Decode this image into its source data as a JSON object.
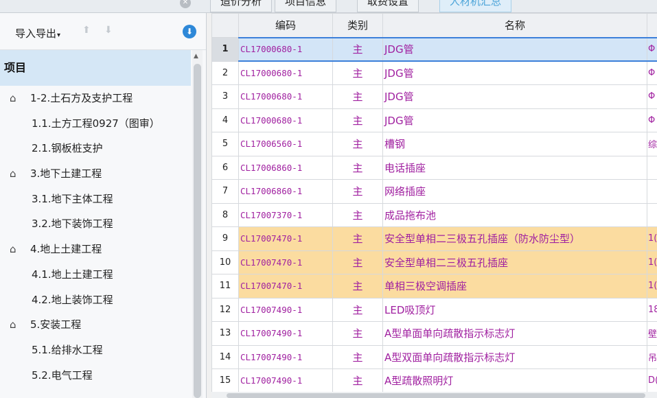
{
  "tabs": [
    {
      "label": "造价分析",
      "active": false
    },
    {
      "label": "项目信息",
      "active": false
    },
    {
      "label": "取费设置",
      "active": false
    },
    {
      "label": "人材机汇总",
      "active": true
    }
  ],
  "toolbar": {
    "import_export_label": "导入导出",
    "up_icon": "arrow-up-icon",
    "down_icon": "arrow-down-icon",
    "download_icon": "download-icon"
  },
  "tree": {
    "root_label": "项目",
    "items": [
      {
        "label": "1-2.土石方及支护工程",
        "level": 1
      },
      {
        "label": "1.1.土方工程0927（图审）",
        "level": 2
      },
      {
        "label": "2.1.钢板桩支护",
        "level": 2
      },
      {
        "label": "3.地下土建工程",
        "level": 1
      },
      {
        "label": "3.1.地下主体工程",
        "level": 2
      },
      {
        "label": "3.2.地下装饰工程",
        "level": 2
      },
      {
        "label": "4.地上土建工程",
        "level": 1
      },
      {
        "label": "4.1.地上土建工程",
        "level": 2
      },
      {
        "label": "4.2.地上装饰工程",
        "level": 2
      },
      {
        "label": "5.安装工程",
        "level": 1
      },
      {
        "label": "5.1.给排水工程",
        "level": 2
      },
      {
        "label": "5.2.电气工程",
        "level": 2
      }
    ]
  },
  "table": {
    "headers": [
      "编码",
      "类别",
      "名称"
    ],
    "rows": [
      {
        "no": "1",
        "code": "CL17000680-1",
        "type": "主",
        "name": "JDG管",
        "spec": "Φ",
        "state": "selected"
      },
      {
        "no": "2",
        "code": "CL17000680-1",
        "type": "主",
        "name": "JDG管",
        "spec": "Φ",
        "state": ""
      },
      {
        "no": "3",
        "code": "CL17000680-1",
        "type": "主",
        "name": "JDG管",
        "spec": "Φ",
        "state": ""
      },
      {
        "no": "4",
        "code": "CL17000680-1",
        "type": "主",
        "name": "JDG管",
        "spec": "Φ",
        "state": ""
      },
      {
        "no": "5",
        "code": "CL17006560-1",
        "type": "主",
        "name": "槽钢",
        "spec": "综",
        "state": ""
      },
      {
        "no": "6",
        "code": "CL17006860-1",
        "type": "主",
        "name": "电话插座",
        "spec": "",
        "state": ""
      },
      {
        "no": "7",
        "code": "CL17006860-1",
        "type": "主",
        "name": "网络插座",
        "spec": "",
        "state": ""
      },
      {
        "no": "8",
        "code": "CL17007370-1",
        "type": "主",
        "name": "成品拖布池",
        "spec": "",
        "state": ""
      },
      {
        "no": "9",
        "code": "CL17007470-1",
        "type": "主",
        "name": "安全型单相二三极五孔插座（防水防尘型）",
        "spec": "1(",
        "state": "highlight"
      },
      {
        "no": "10",
        "code": "CL17007470-1",
        "type": "主",
        "name": "安全型单相二三极五孔插座",
        "spec": "1(",
        "state": "highlight"
      },
      {
        "no": "11",
        "code": "CL17007470-1",
        "type": "主",
        "name": "单相三极空调插座",
        "spec": "1(",
        "state": "highlight"
      },
      {
        "no": "12",
        "code": "CL17007490-1",
        "type": "主",
        "name": "LED吸顶灯",
        "spec": "18",
        "state": ""
      },
      {
        "no": "13",
        "code": "CL17007490-1",
        "type": "主",
        "name": "A型单面单向疏散指示标志灯",
        "spec": "壁",
        "state": ""
      },
      {
        "no": "14",
        "code": "CL17007490-1",
        "type": "主",
        "name": "A型双面单向疏散指示标志灯",
        "spec": "吊",
        "state": ""
      },
      {
        "no": "15",
        "code": "CL17007490-1",
        "type": "主",
        "name": "A型疏散照明灯",
        "spec": "D(",
        "state": ""
      }
    ]
  },
  "colors": {
    "selection": "#d3e5f7",
    "highlight": "#fbdca0",
    "text_purple": "#a020a0",
    "active_tab": "#4aa3d8"
  }
}
